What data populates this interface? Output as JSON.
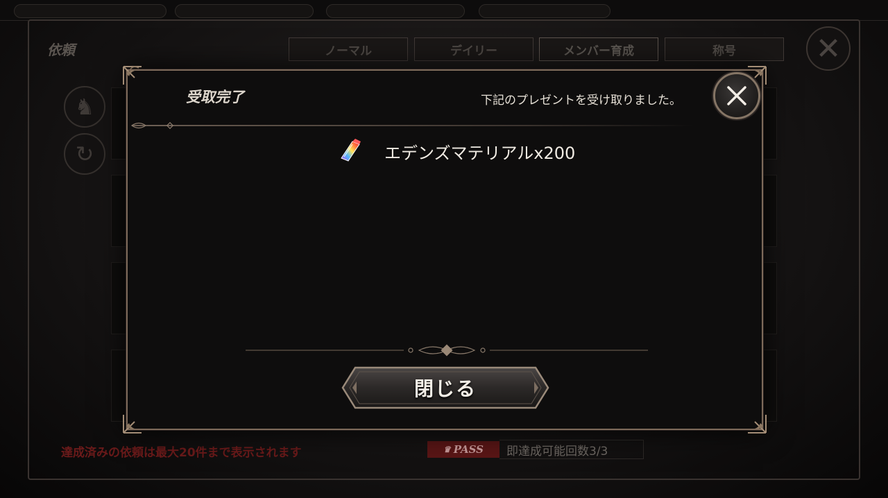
{
  "background": {
    "window_title": "依頼",
    "tabs": [
      {
        "label": "ノーマル",
        "active": false
      },
      {
        "label": "デイリー",
        "active": false
      },
      {
        "label": "メンバー育成",
        "active": true
      },
      {
        "label": "称号",
        "active": false
      }
    ],
    "close_icon": "close-icon",
    "side_buttons": [
      "helmet-icon",
      "refresh-icon"
    ],
    "footer_notice": "達成済みの依頼は最大20件まで表示されます",
    "pass_badge": "PASS",
    "pass_count_text": "即達成可能回数3/3"
  },
  "modal": {
    "title": "受取完了",
    "message": "下記のプレゼントを受け取りました。",
    "reward": {
      "icon": "crystal-icon",
      "label": "エデンズマテリアルx200"
    },
    "close_button_label": "閉じる",
    "close_icon": "close-icon"
  },
  "colors": {
    "frame_gold": "#7d6a5a",
    "panel_bg": "#0e0d0d",
    "text_primary": "#f0ebe3",
    "pass_red": "#5a1616"
  }
}
